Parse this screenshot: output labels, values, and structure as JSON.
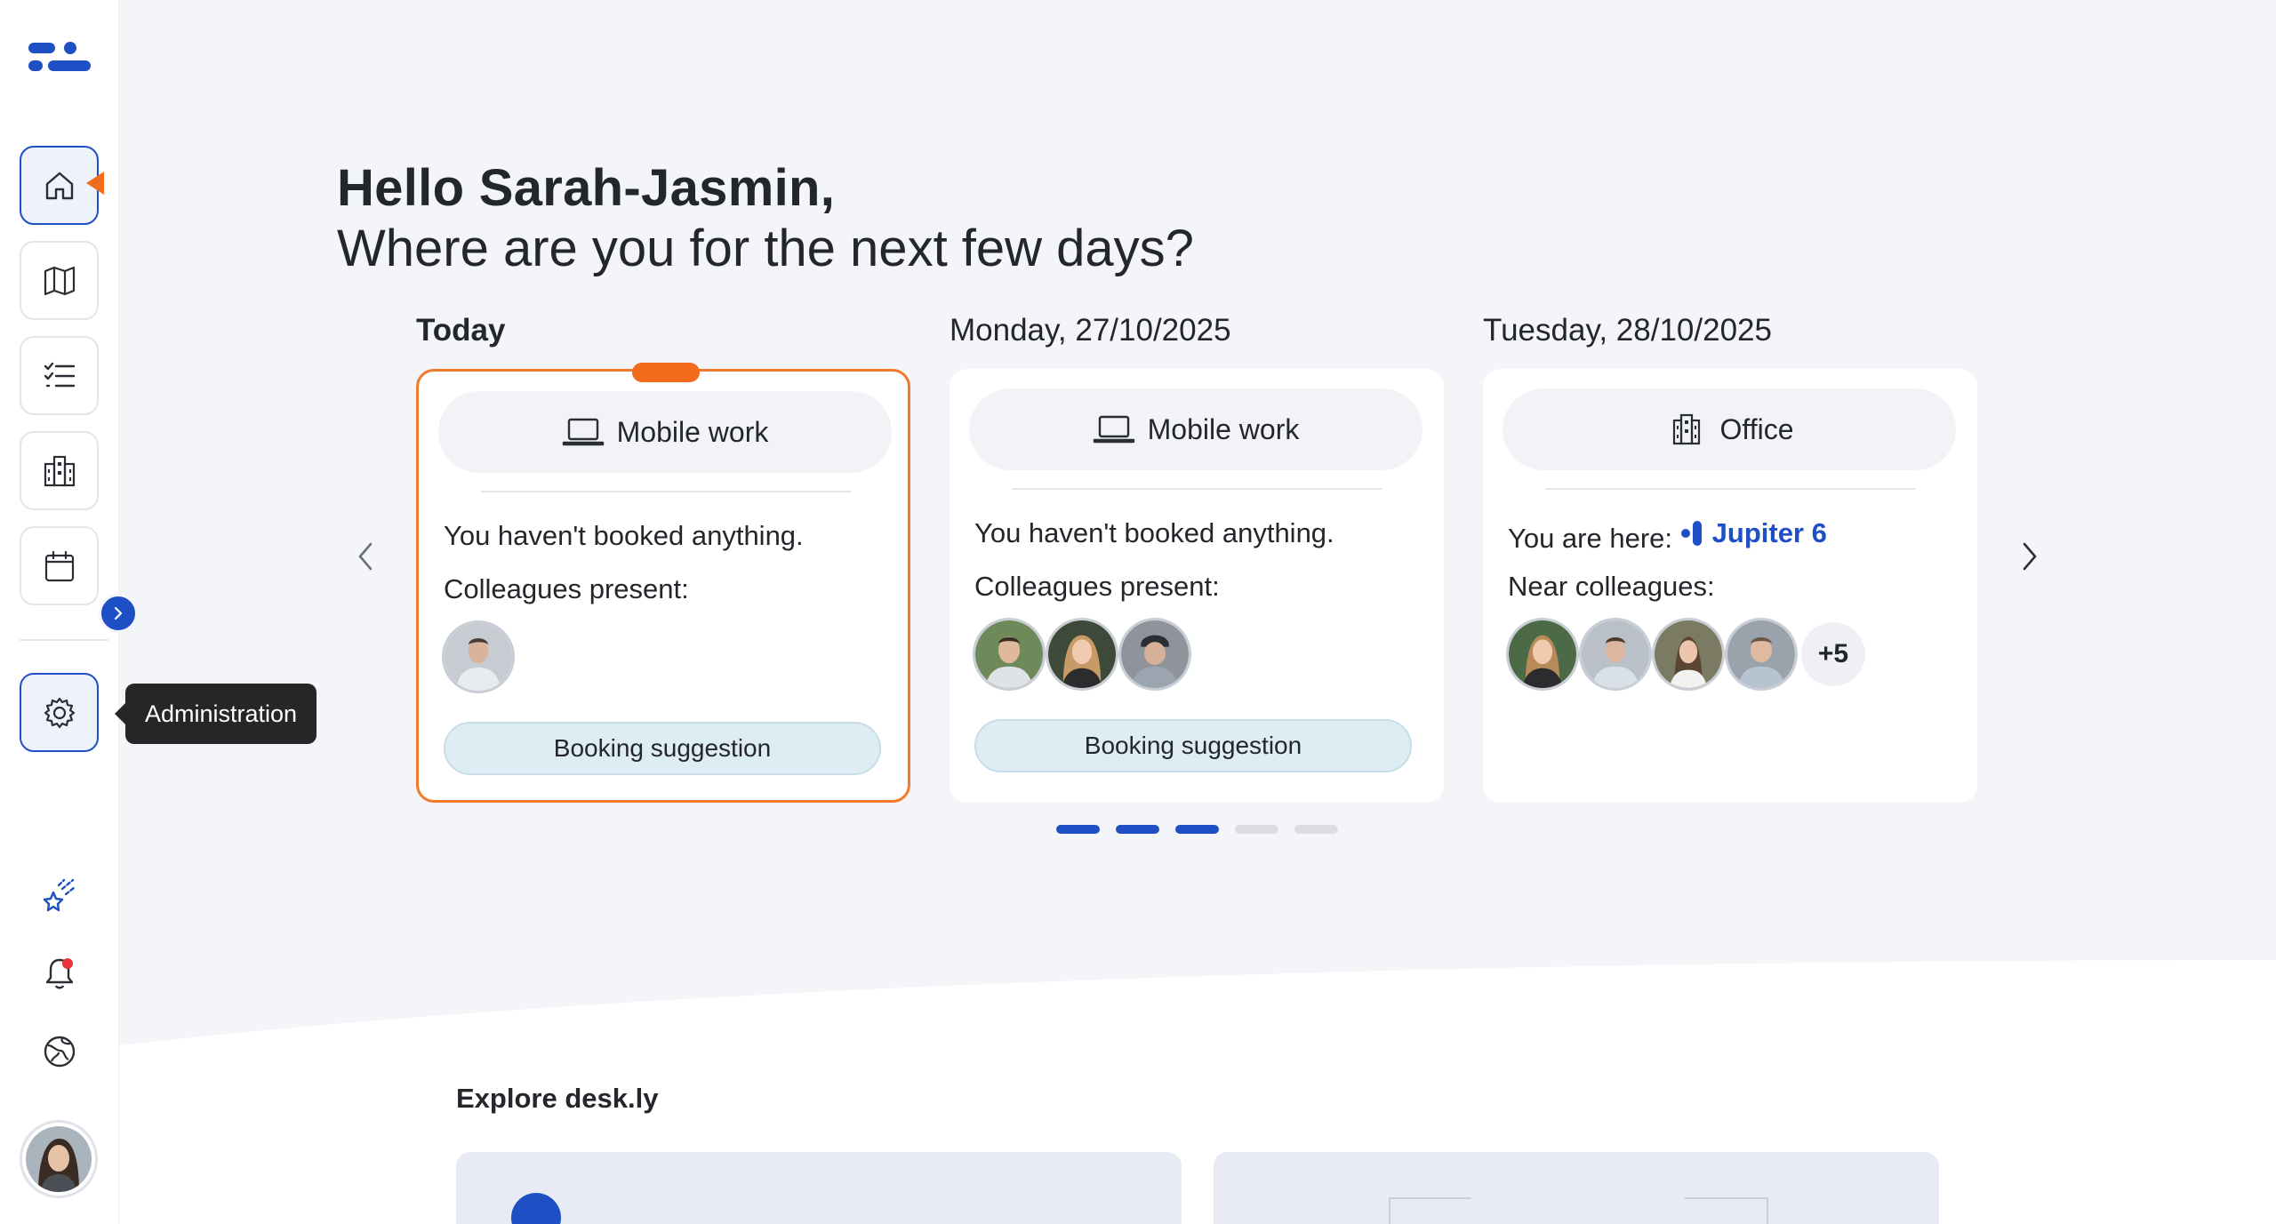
{
  "greeting": {
    "title": "Hello Sarah-Jasmin,",
    "subtitle": "Where are you for the next few days?"
  },
  "sidebar": {
    "items": [
      {
        "name": "home",
        "icon": "home-icon",
        "active": true
      },
      {
        "name": "map",
        "icon": "map-icon"
      },
      {
        "name": "tasks",
        "icon": "checklist-icon"
      },
      {
        "name": "buildings",
        "icon": "building-icon"
      },
      {
        "name": "calendar",
        "icon": "calendar-icon"
      }
    ],
    "admin_tooltip": "Administration",
    "bottom_icons": [
      "sparkle-star-icon",
      "bell-icon",
      "globe-icon"
    ]
  },
  "days": [
    {
      "label": "Today",
      "mode": "Mobile work",
      "mode_icon": "laptop-icon",
      "status": "You haven't booked anything.",
      "people_label": "Colleagues present:",
      "button": "Booking suggestion"
    },
    {
      "label": "Monday, 27/10/2025",
      "mode": "Mobile work",
      "mode_icon": "laptop-icon",
      "status": "You haven't booked anything.",
      "people_label": "Colleagues present:",
      "button": "Booking suggestion"
    },
    {
      "label": "Tuesday, 28/10/2025",
      "mode": "Office",
      "mode_icon": "building-icon",
      "location_prefix": "You are here:",
      "location": "Jupiter 6",
      "people_label": "Near colleagues:",
      "more": "+5"
    }
  ],
  "carousel": {
    "pages": 5,
    "active_pages": 3
  },
  "explore": {
    "title": "Explore desk.ly"
  },
  "colors": {
    "accent": "#1f4fc5",
    "highlight": "#f26b1d",
    "background": "#f4f5f9"
  }
}
